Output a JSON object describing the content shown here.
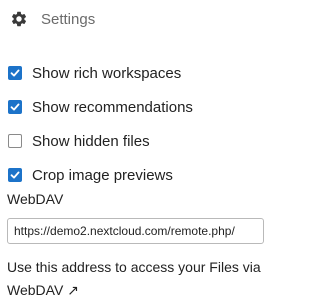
{
  "header": {
    "icon": "gear-icon",
    "title": "Settings"
  },
  "options": [
    {
      "label": "Show rich workspaces",
      "checked": true
    },
    {
      "label": "Show recommendations",
      "checked": true
    },
    {
      "label": "Show hidden files",
      "checked": false
    },
    {
      "label": "Crop image previews",
      "checked": true
    }
  ],
  "webdav": {
    "title": "WebDAV",
    "url": "https://demo2.nextcloud.com/remote.php/",
    "hint_text": "Use this address to access your Files via",
    "link_label": "WebDAV ↗"
  },
  "colors": {
    "accent": "#1c73c9",
    "text": "#222222",
    "muted": "#6b6b6b"
  }
}
